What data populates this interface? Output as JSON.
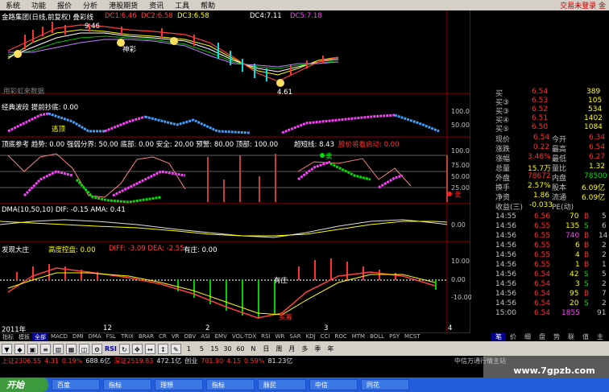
{
  "menu": {
    "items": [
      "系统",
      "功能",
      "报价",
      "分析",
      "港股期货",
      "资讯",
      "工具",
      "帮助"
    ],
    "status": "交易未登录 金"
  },
  "panels": {
    "main_title": "金路集团(日线,前复权) 叠彩线",
    "dc": [
      "DC1:6.46",
      "DC2:6.58",
      "DC3:6.58",
      "DC4:7.11",
      "DC5:7.18"
    ],
    "price_labels": [
      "9.46",
      "神彩",
      "4.61"
    ],
    "watermark": "用彩虹来数据",
    "p2_title": "经典波段 提前抄底: 0.00",
    "p2_label": "逃顶",
    "p2_axis": [
      "100.0",
      "50.00"
    ],
    "p3_title": "顶底参考 趋势: 0.00 强弱分界: 50.00 底部: 0.00 安全: 20.00 预警: 80.00 顶部: 100.00",
    "p3_extra": "超短线: 8.43",
    "p3_warn": "股价将看启动: 0.00",
    "p3_marks": [
      "卖",
      "卖"
    ],
    "p3_axis": [
      "100.0",
      "75.00",
      "50.00",
      "25.00"
    ],
    "p4_title": "DMA(10,50,10) DIF: -0.15 AMA: 0.41",
    "p4_axis": [
      "0.00"
    ],
    "p5_title": "发现大庄",
    "p5_a": "高度控盘: 0.00",
    "p5_b": "DIFF: -3.09 DEA: -2.55",
    "p5_c": "有庄: 0.00",
    "p5_marks": [
      "有庄",
      "买筹"
    ],
    "p5_axis": [
      "10.00",
      "0.00",
      "-10.00"
    ],
    "x_labels": [
      "2011年",
      "12",
      "2",
      "3",
      "4",
      "日线"
    ]
  },
  "quote": {
    "asks": [
      [
        "买",
        "6.54",
        "389"
      ],
      [
        "买③",
        "6.53",
        "105"
      ],
      [
        "买③",
        "6.52",
        "534"
      ],
      [
        "买④",
        "6.51",
        "1402"
      ],
      [
        "买⑤",
        "6.50",
        "1084"
      ]
    ],
    "stats": [
      [
        "现价",
        "6.54",
        "今开",
        "6.34"
      ],
      [
        "涨跌",
        "0.22",
        "最高",
        "6.54"
      ],
      [
        "涨幅",
        "3.48%",
        "最低",
        "6.27"
      ],
      [
        "总量",
        "15.7万",
        "量比",
        "1.32"
      ],
      [
        "外盘",
        "78672",
        "内盘",
        "78500"
      ],
      [
        "换手",
        "2.57%",
        "股本",
        "6.09亿"
      ],
      [
        "净资",
        "1.86",
        "流通",
        "6.09亿"
      ],
      [
        "收益(三)",
        "-0.033",
        "PE(动)",
        ""
      ]
    ],
    "ticks": [
      [
        "14:55",
        "6.56",
        "70",
        "B",
        "5"
      ],
      [
        "14:56",
        "6.55",
        "135",
        "S",
        "6"
      ],
      [
        "14:56",
        "6.55",
        "740",
        "B",
        "14"
      ],
      [
        "14:56",
        "6.55",
        "6",
        "B",
        "2"
      ],
      [
        "14:56",
        "6.55",
        "4",
        "B",
        "2"
      ],
      [
        "14:56",
        "6.55",
        "1",
        "B",
        "1"
      ],
      [
        "14:56",
        "6.54",
        "42",
        "S",
        "5"
      ],
      [
        "14:56",
        "6.54",
        "3",
        "S",
        "2"
      ],
      [
        "14:56",
        "6.54",
        "95",
        "B",
        "7"
      ],
      [
        "14:56",
        "6.54",
        "20",
        "S",
        "2"
      ],
      [
        "15:00",
        "6.54",
        "1855",
        "",
        "91"
      ]
    ]
  },
  "indicator_tabs": [
    "指标",
    "模板",
    "全部",
    "MACD",
    "DMI",
    "DMA",
    "FSL",
    "TRIX",
    "BRAR",
    "CR",
    "VR",
    "OBV",
    "ASI",
    "EMV",
    "VOL-TDX",
    "RSI",
    "WR",
    "SAR",
    "KDJ",
    "CCI",
    "ROC",
    "MTM",
    "BOLL",
    "PSY",
    "MCST"
  ],
  "right_tabs": [
    "笔",
    "价",
    "细",
    "盘",
    "势",
    "联",
    "值",
    "主"
  ],
  "toolbar": [
    "▼",
    "◆",
    "▣",
    "≡",
    "▥",
    "▦",
    "◫",
    "⚙",
    "RSI",
    "↻",
    "✥",
    "↔",
    "↕",
    "✎",
    "1",
    "5",
    "15",
    "30",
    "60",
    "N",
    "日",
    "周",
    "月",
    "多",
    "季",
    "年"
  ],
  "status": {
    "sh": "上证2306.55",
    "sh_chg": "4.31",
    "sh_pct": "0.19%",
    "sh_amt": "688.6亿",
    "sz": "深证2519.83",
    "sz_chg": "",
    "sz_pct": "",
    "sz_amt": "472.1亿",
    "cy": "创业",
    "cy_v": "701.90",
    "cy_chg": "4.15",
    "cy_pct": "0.59%",
    "cy_amt": "81.23亿",
    "broker": "中信万通行情主站",
    "site": "www.7gpzb.com"
  },
  "taskbar": {
    "start": "开始",
    "tasks": [
      "百度",
      "指标",
      "理想",
      "指标",
      "脉民",
      "中信",
      "同花"
    ]
  },
  "chart_data": {
    "type": "line",
    "title": "金路集团(日线,前复权) 叠彩线",
    "series": [
      {
        "name": "DIF",
        "values": [
          0.1,
          0.6,
          0.4,
          0.0,
          -0.6,
          -1.3,
          -1.9,
          -2.2,
          -2.0,
          -1.3,
          -0.5,
          0.3,
          1.0,
          0.9,
          0.4,
          -0.15
        ]
      },
      {
        "name": "AMA",
        "values": [
          0.3,
          0.5,
          0.6,
          0.4,
          0.0,
          -0.6,
          -1.3,
          -1.8,
          -2.0,
          -1.8,
          -1.2,
          -0.4,
          0.3,
          0.7,
          0.6,
          0.41
        ]
      }
    ]
  }
}
